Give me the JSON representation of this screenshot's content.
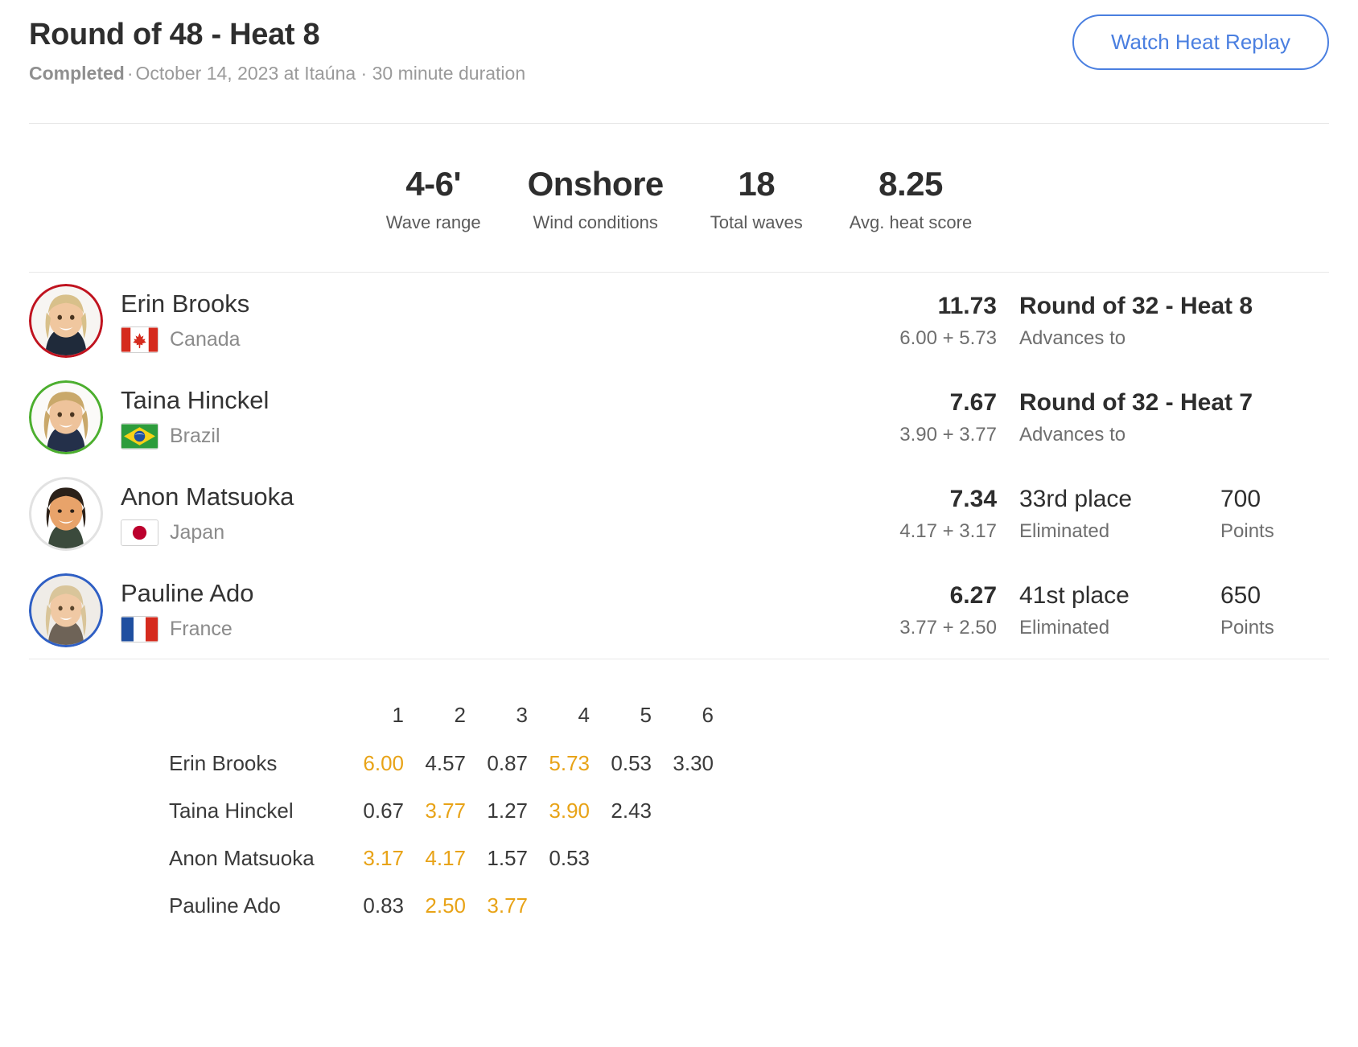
{
  "header": {
    "title": "Round of 48 - Heat 8",
    "status": "Completed",
    "meta": "October 14, 2023 at Itaúna · 30 minute duration",
    "separator": "·",
    "replay_label": "Watch Heat Replay",
    "replay_color": "#4a7fe0"
  },
  "stats": [
    {
      "value": "4-6'",
      "label": "Wave range"
    },
    {
      "value": "Onshore",
      "label": "Wind conditions"
    },
    {
      "value": "18",
      "label": "Total waves"
    },
    {
      "value": "8.25",
      "label": "Avg. heat score"
    }
  ],
  "athletes": [
    {
      "name": "Erin Brooks",
      "country": "Canada",
      "flag": "flag-canada",
      "ring_color": "#c0131f",
      "total": "11.73",
      "parts": "6.00 + 5.73",
      "result": "Round of 32 - Heat 8",
      "result_bold": true,
      "result_sub": "Advances to",
      "points": "",
      "points_label": ""
    },
    {
      "name": "Taina Hinckel",
      "country": "Brazil",
      "flag": "flag-brazil",
      "ring_color": "#4caf2e",
      "total": "7.67",
      "parts": "3.90 + 3.77",
      "result": "Round of 32 - Heat 7",
      "result_bold": true,
      "result_sub": "Advances to",
      "points": "",
      "points_label": ""
    },
    {
      "name": "Anon Matsuoka",
      "country": "Japan",
      "flag": "flag-japan",
      "ring_color": "#e2e2e2",
      "total": "7.34",
      "parts": "4.17 + 3.17",
      "result": "33rd place",
      "result_bold": false,
      "result_sub": "Eliminated",
      "points": "700",
      "points_label": "Points"
    },
    {
      "name": "Pauline Ado",
      "country": "France",
      "flag": "flag-france",
      "ring_color": "#2f5fc4",
      "total": "6.27",
      "parts": "3.77 + 2.50",
      "result": "41st place",
      "result_bold": false,
      "result_sub": "Eliminated",
      "points": "650",
      "points_label": "Points"
    }
  ],
  "wave_table": {
    "columns": [
      "1",
      "2",
      "3",
      "4",
      "5",
      "6"
    ],
    "counted_color": "#e8a317",
    "rows": [
      {
        "name": "Erin Brooks",
        "scores": [
          "6.00",
          "4.57",
          "0.87",
          "5.73",
          "0.53",
          "3.30"
        ],
        "counted": [
          true,
          false,
          false,
          true,
          false,
          false
        ]
      },
      {
        "name": "Taina Hinckel",
        "scores": [
          "0.67",
          "3.77",
          "1.27",
          "3.90",
          "2.43"
        ],
        "counted": [
          false,
          true,
          false,
          true,
          false
        ]
      },
      {
        "name": "Anon Matsuoka",
        "scores": [
          "3.17",
          "4.17",
          "1.57",
          "0.53"
        ],
        "counted": [
          true,
          true,
          false,
          false
        ]
      },
      {
        "name": "Pauline Ado",
        "scores": [
          "0.83",
          "2.50",
          "3.77"
        ],
        "counted": [
          false,
          true,
          true
        ]
      }
    ]
  }
}
